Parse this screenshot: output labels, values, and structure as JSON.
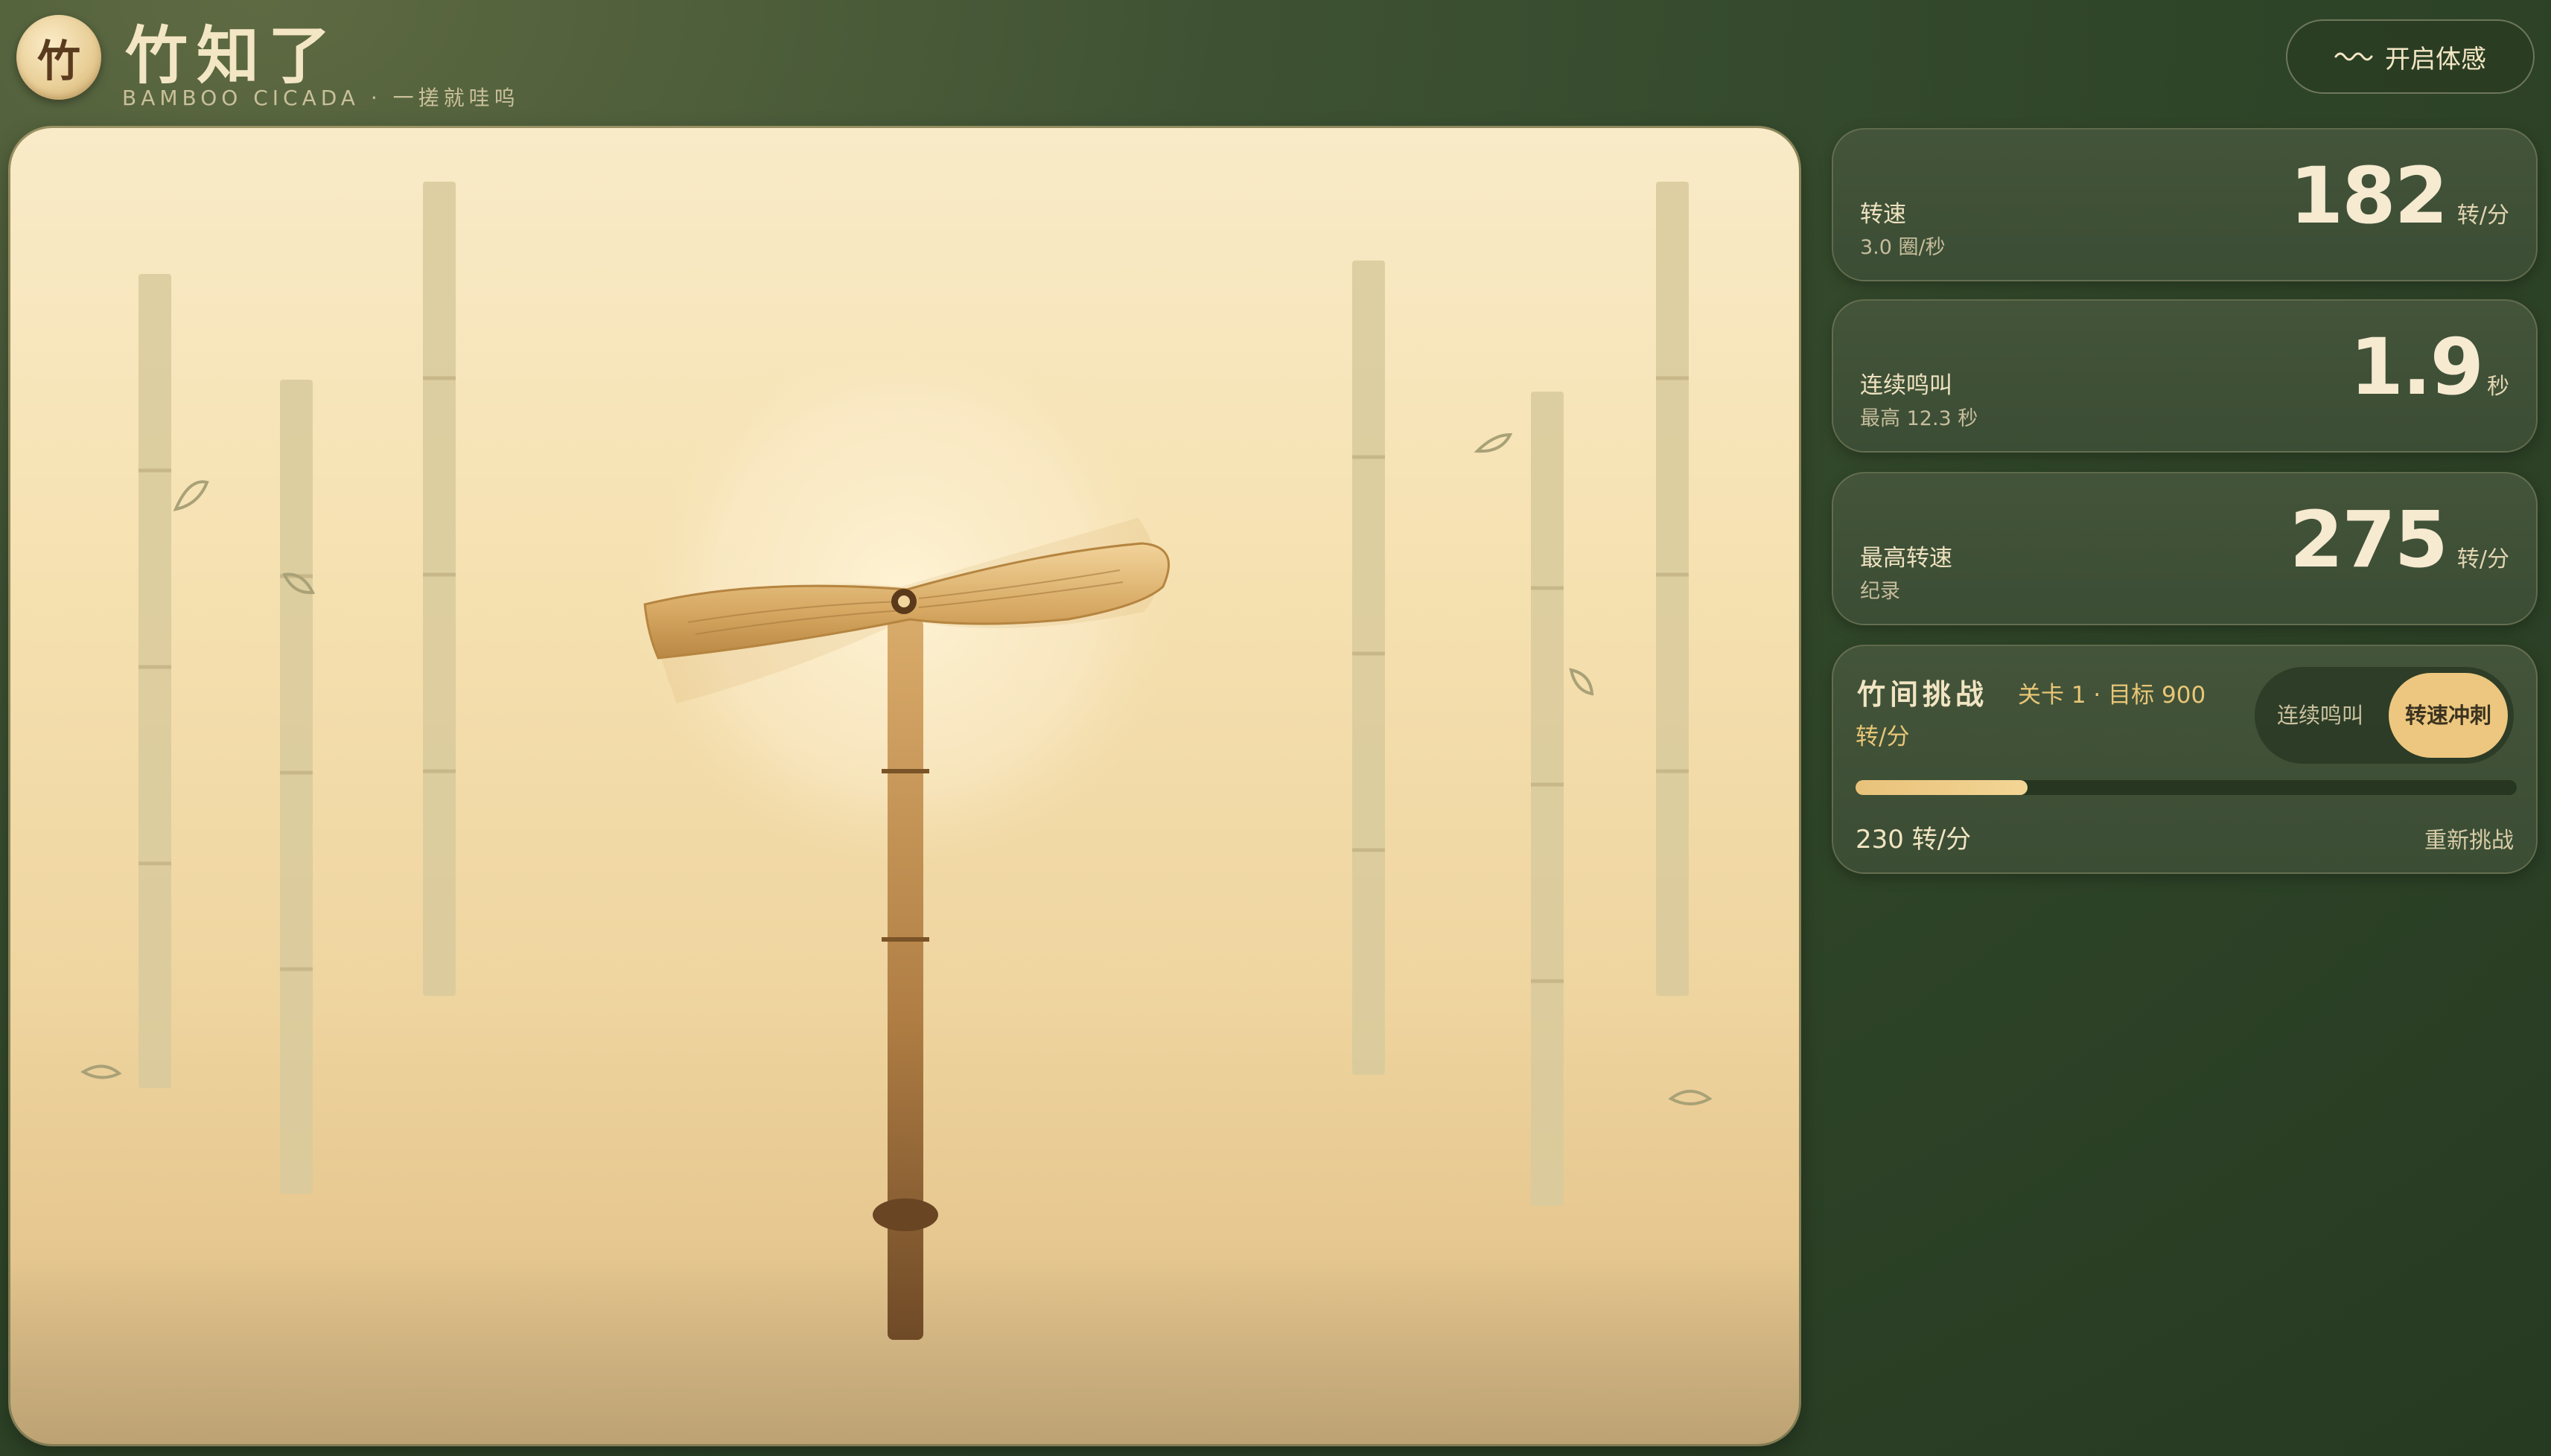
{
  "header": {
    "logo_char": "竹",
    "title": "竹知了",
    "subtitle": "BAMBOO CICADA · 一搓就哇呜",
    "sense_button_label": "开启体感"
  },
  "stats": {
    "speed": {
      "label": "转速",
      "sub": "3.0 圈/秒",
      "value": "182",
      "unit": "转/分"
    },
    "chirp": {
      "label": "连续鸣叫",
      "sub": "最高 12.3 秒",
      "value": "1.9",
      "unit": "秒"
    },
    "max_speed": {
      "label": "最高转速",
      "sub": "纪录",
      "value": "275",
      "unit": "转/分"
    }
  },
  "challenge": {
    "title": "竹间挑战",
    "level": "关卡 1 · 目标 900",
    "level_unit": "转/分",
    "modes": [
      "连续鸣叫",
      "转速冲刺"
    ],
    "active_mode": "转速冲刺",
    "progress": 0.26,
    "current": "230 转/分",
    "retry_label": "重新挑战"
  },
  "colors": {
    "background": "#2f4528",
    "accent": "#edc77f",
    "card": "#3e5036",
    "stage": "#f6e2b3"
  }
}
